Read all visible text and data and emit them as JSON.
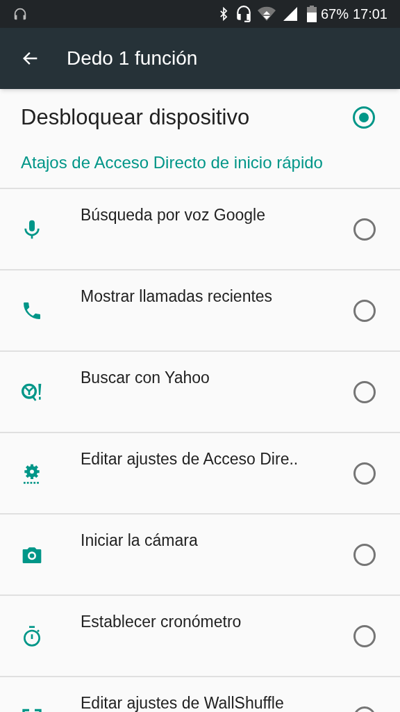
{
  "status_bar": {
    "battery": "67%",
    "time": "17:01"
  },
  "app_bar": {
    "title": "Dedo 1 función"
  },
  "main_option": {
    "label": "Desbloquear dispositivo",
    "selected": true
  },
  "section_header": "Atajos de Acceso Directo de inicio rápido",
  "items": [
    {
      "kind": "mic",
      "label": "Búsqueda por voz Google",
      "selected": false
    },
    {
      "kind": "phone",
      "label": "Mostrar llamadas recientes",
      "selected": false
    },
    {
      "kind": "yahoo",
      "label": "Buscar con Yahoo",
      "selected": false
    },
    {
      "kind": "gear",
      "label": "Editar ajustes de Acceso Dire..",
      "selected": false
    },
    {
      "kind": "camera",
      "label": "Iniciar la cámara",
      "selected": false
    },
    {
      "kind": "timer",
      "label": "Establecer cronómetro",
      "selected": false
    },
    {
      "kind": "wallpaper",
      "label": "Editar ajustes de WallShuffle",
      "selected": false
    }
  ]
}
